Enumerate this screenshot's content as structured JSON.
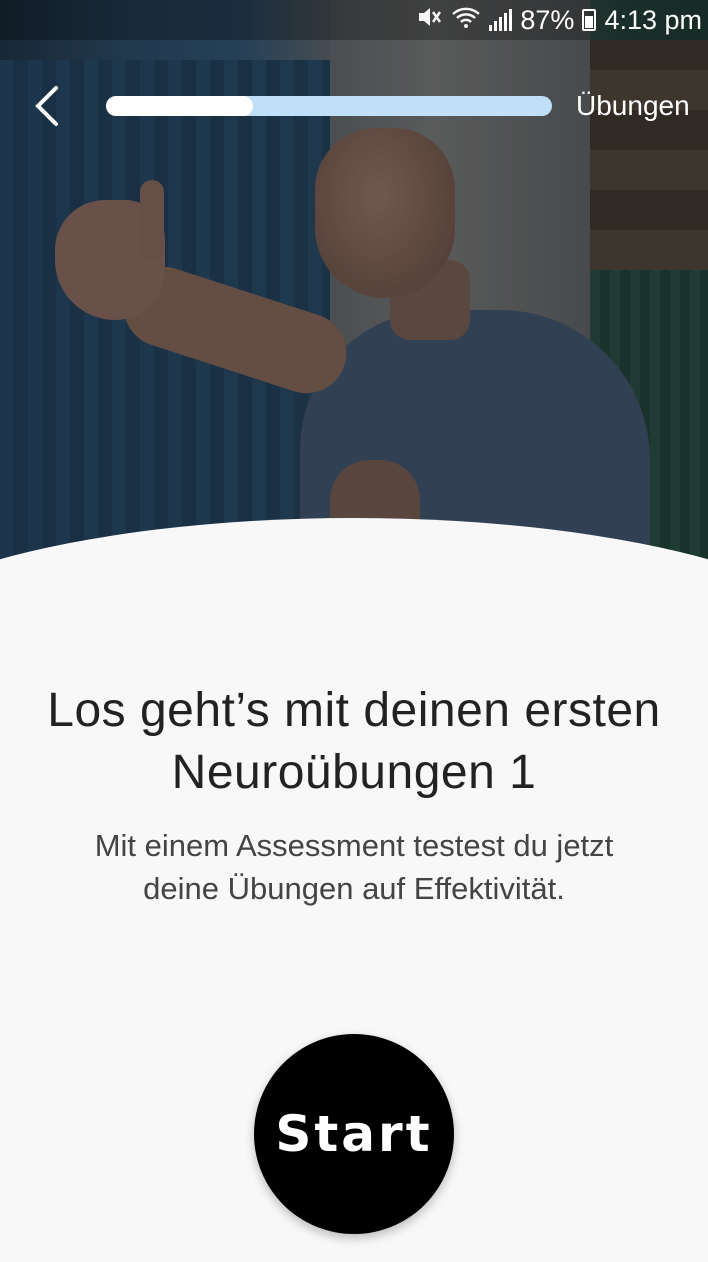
{
  "status_bar": {
    "mute_icon": "mute-icon",
    "wifi_icon": "wifi-icon",
    "signal_icon": "signal-icon",
    "battery_percent": "87%",
    "battery_icon": "battery-charging-icon",
    "time": "4:13 pm"
  },
  "header": {
    "back_icon": "chevron-left-icon",
    "progress": 0.33,
    "progress_track_color": "#bfe0f7",
    "progress_fill_color": "#ffffff",
    "label": "Übungen"
  },
  "hero": {
    "image": "man-pointing-thumb-gesture-photo"
  },
  "content": {
    "title_line1": "Los geht’s mit deinen ersten",
    "title_line2": "Neuroübungen 1",
    "subtitle_line1": "Mit einem Assessment testest du jetzt",
    "subtitle_line2": "deine Übungen auf Effektivität."
  },
  "actions": {
    "start_label": "Start"
  }
}
